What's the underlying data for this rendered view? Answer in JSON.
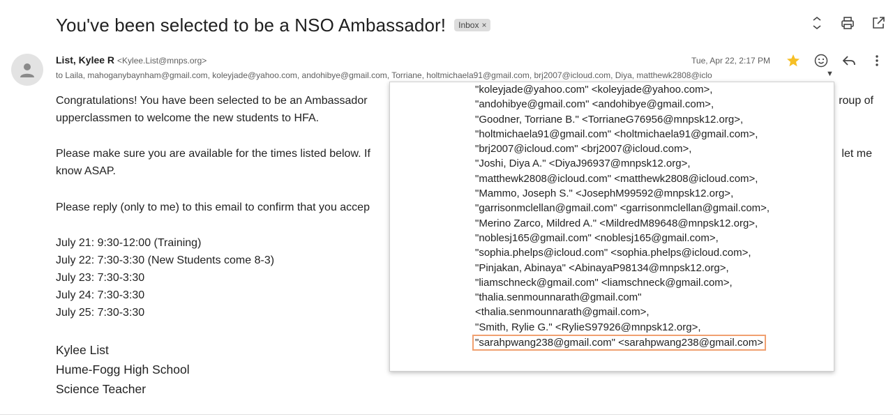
{
  "header": {
    "subject": "You've been selected to be a NSO Ambassador!",
    "label_chip": "Inbox",
    "label_chip_close": "×",
    "icons": [
      "expand-collapse-icon",
      "print-icon",
      "open-in-new-window-icon"
    ]
  },
  "message": {
    "sender_name": "List, Kylee R",
    "sender_email": "<Kylee.List@mnps.org>",
    "to_line": "to Laila, mahoganybaynham@gmail.com, koleyjade@yahoo.com, andohibye@gmail.com, Torriane, holtmichaela91@gmail.com, brj2007@icloud.com, Diya, matthewk2808@iclo",
    "date": "Tue, Apr 22, 2:17 PM",
    "starred": true,
    "accent_star_color": "#f6bf26",
    "actions": [
      "star-icon",
      "emoji-reaction-icon",
      "reply-icon",
      "more-options-icon"
    ]
  },
  "body": {
    "para1_left": "Congratulations! You have been selected to be an Ambassador",
    "para1_right": "roup of",
    "para1_line2": "upperclassmen to welcome the new students to HFA.",
    "para2_left": "Please make sure you are available for the times listed below. If",
    "para2_right": "let me",
    "para2_line2": "know ASAP.",
    "para3": "Please reply (only to me) to this email to confirm that you accep",
    "schedule": [
      "July 21: 9:30-12:00 (Training)",
      "July 22: 7:30-3:30 (New Students come 8-3)",
      "July 23: 7:30-3:30",
      "July 24: 7:30-3:30",
      "July 25: 7:30-3:30"
    ],
    "signature": [
      "Kylee List",
      "Hume-Fogg High School",
      "Science Teacher"
    ]
  },
  "recipients_popup": {
    "lines": [
      "\"koleyjade@yahoo.com\" <koleyjade@yahoo.com>,",
      "\"andohibye@gmail.com\" <andohibye@gmail.com>,",
      "\"Goodner, Torriane B.\" <TorrianeG76956@mnpsk12.org>,",
      "\"holtmichaela91@gmail.com\" <holtmichaela91@gmail.com>,",
      "\"brj2007@icloud.com\" <brj2007@icloud.com>,",
      "\"Joshi, Diya A.\" <DiyaJ96937@mnpsk12.org>,",
      "\"matthewk2808@icloud.com\" <matthewk2808@icloud.com>,",
      "\"Mammo, Joseph S.\" <JosephM99592@mnpsk12.org>,",
      "\"garrisonmclellan@gmail.com\" <garrisonmclellan@gmail.com>,",
      "\"Merino Zarco, Mildred A.\" <MildredM89648@mnpsk12.org>,",
      "\"noblesj165@gmail.com\" <noblesj165@gmail.com>,",
      "\"sophia.phelps@icloud.com\" <sophia.phelps@icloud.com>,",
      "\"Pinjakan, Abinaya\" <AbinayaP98134@mnpsk12.org>,",
      "\"liamschneck@gmail.com\" <liamschneck@gmail.com>,",
      "\"thalia.senmounnarath@gmail.com\"",
      "<thalia.senmounnarath@gmail.com>,",
      "\"Smith, Rylie G.\" <RylieS97926@mnpsk12.org>,"
    ],
    "highlighted_line": "\"sarahpwang238@gmail.com\" <sarahpwang238@gmail.com>",
    "highlight_color": "#f0a070"
  }
}
